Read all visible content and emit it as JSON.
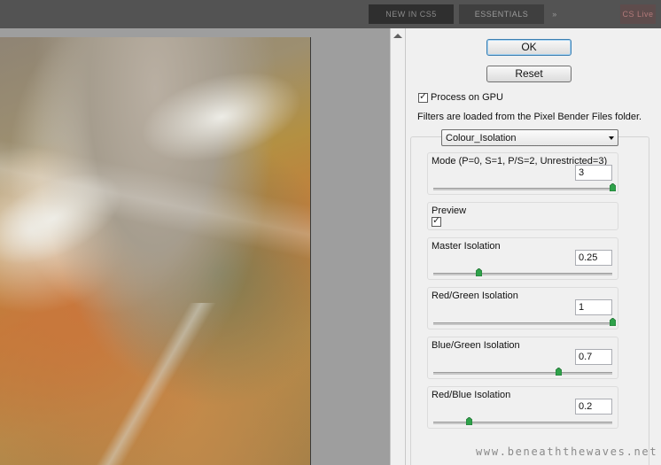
{
  "topbar": {
    "workspace_a": "NEW IN CS5",
    "workspace_b": "ESSENTIALS",
    "more": "»",
    "live": "CS Live"
  },
  "panel": {
    "ok_label": "OK",
    "reset_label": "Reset",
    "gpu_label": "Process on GPU",
    "gpu_checked": true,
    "info": "Filters are loaded from the Pixel Bender Files folder.",
    "filter_selected": "Colour_Isolation"
  },
  "params": {
    "mode": {
      "label": "Mode (P=0, S=1, P/S=2, Unrestricted=3)",
      "value": "3",
      "slider": 1.0
    },
    "preview": {
      "label": "Preview",
      "checked": true
    },
    "master": {
      "label": "Master Isolation",
      "value": "0.25",
      "slider": 0.25
    },
    "red_green": {
      "label": "Red/Green Isolation",
      "value": "1",
      "slider": 1.0
    },
    "blue_green": {
      "label": "Blue/Green Isolation",
      "value": "0.7",
      "slider": 0.7
    },
    "red_blue": {
      "label": "Red/Blue Isolation",
      "value": "0.2",
      "slider": 0.2
    }
  },
  "watermark": "www.beneaththewaves.net",
  "colors": {
    "ok_border": "#3c7fb1",
    "thumb_fill": "#2fa24a"
  }
}
